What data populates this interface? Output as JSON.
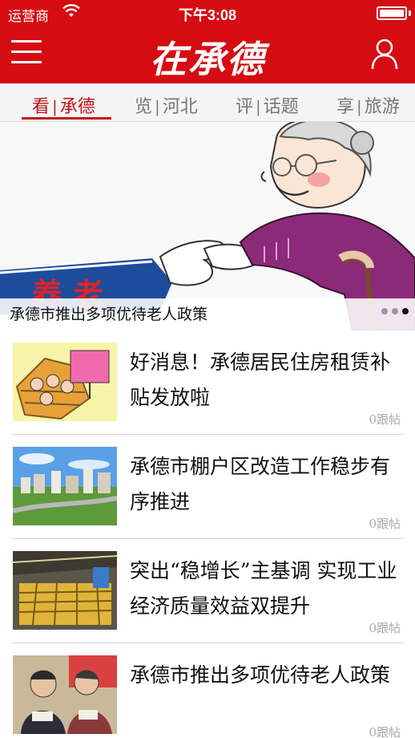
{
  "status_bar": {
    "carrier": "运营商",
    "time": "下午3:08",
    "battery_level": 1.0
  },
  "header": {
    "title": "在承德",
    "menu_icon": "hamburger-menu-icon",
    "user_icon": "user-profile-icon"
  },
  "tabs": [
    {
      "left": "看",
      "right": "承德",
      "active": true
    },
    {
      "left": "览",
      "right": "河北",
      "active": false
    },
    {
      "left": "评",
      "right": "话题",
      "active": false
    },
    {
      "left": "享",
      "right": "旅游",
      "active": false
    }
  ],
  "carousel": {
    "caption": "承德市推出多项优待老人政策",
    "banner_text": "养 老",
    "slides": 3,
    "active_slide": 3
  },
  "news": [
    {
      "title": "好消息！承德居民住房租赁补贴发放啦",
      "comments": "0跟帖"
    },
    {
      "title": "承德市棚户区改造工作稳步有序推进",
      "comments": "0跟帖"
    },
    {
      "title": "突出“稳增长”主基调 实现工业经济质量效益双提升",
      "comments": "0跟帖"
    },
    {
      "title": "承德市推出多项优待老人政策",
      "comments": "0跟帖"
    }
  ],
  "colors": {
    "brand_red": "#d50d13",
    "active_tab": "#c0121a"
  }
}
